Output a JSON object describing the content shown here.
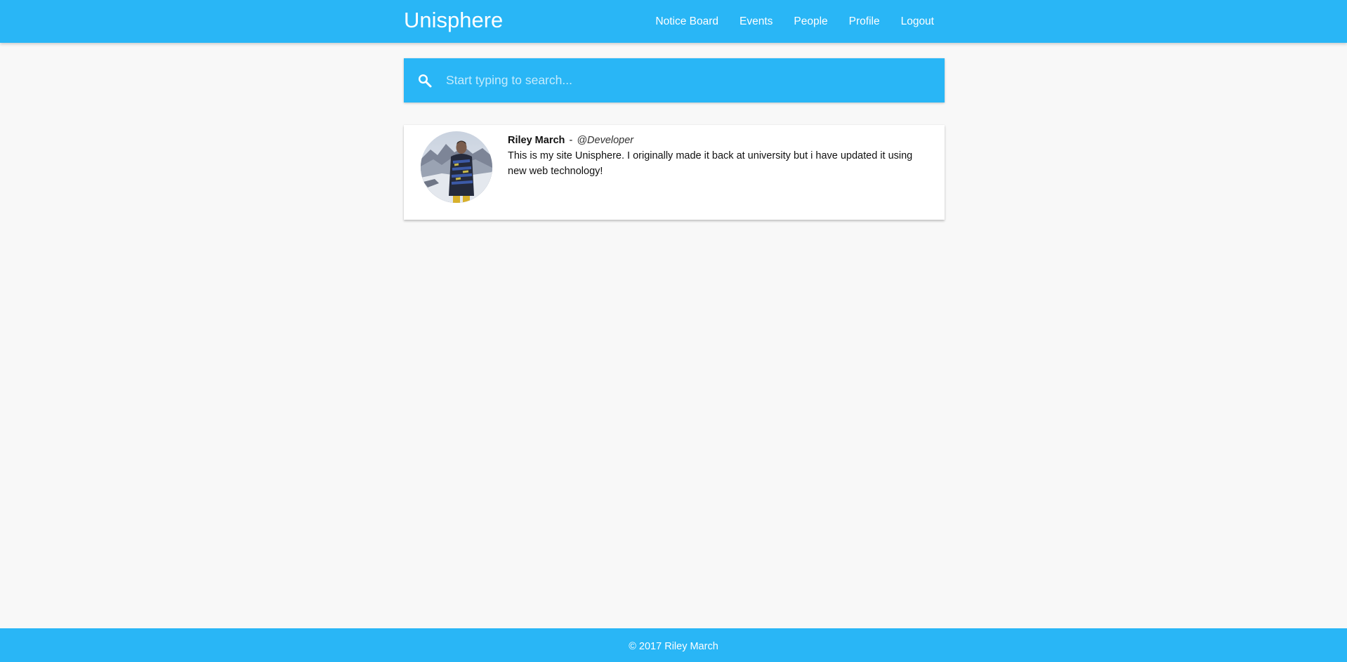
{
  "navbar": {
    "brand": "Unisphere",
    "links": [
      {
        "label": "Notice Board"
      },
      {
        "label": "Events"
      },
      {
        "label": "People"
      },
      {
        "label": "Profile"
      },
      {
        "label": "Logout"
      }
    ]
  },
  "search": {
    "placeholder": "Start typing to search...",
    "value": "",
    "icon": "search-icon"
  },
  "results": [
    {
      "name": "Riley March",
      "separator": "-",
      "role": "@Developer",
      "text": "This is my site Unisphere. I originally made it back at university but i have updated it using new web technology!",
      "avatar": "profile-photo"
    }
  ],
  "footer": {
    "text": "© 2017 Riley March"
  },
  "colors": {
    "primary": "#29b6f6",
    "background": "#f8f8f8",
    "card": "#ffffff",
    "text": "#111111"
  }
}
